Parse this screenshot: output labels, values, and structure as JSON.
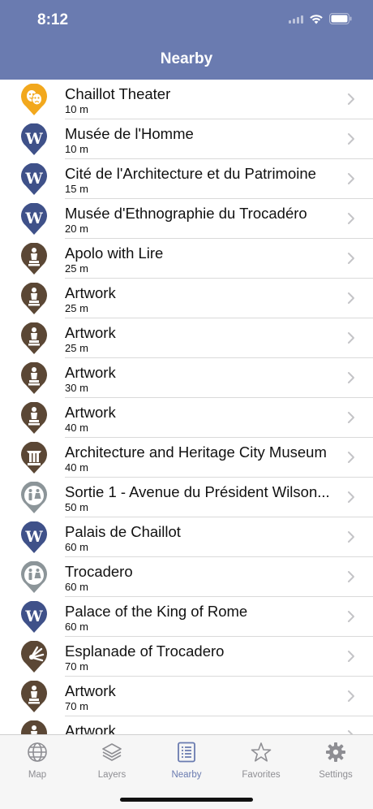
{
  "status": {
    "time": "8:12"
  },
  "nav": {
    "title": "Nearby"
  },
  "colors": {
    "header": "#6a7bb0",
    "wikipedia": "#3f5189",
    "artwork": "#5b4735",
    "theater": "#f2a81d",
    "transit": "#8c9599",
    "tab_active": "#6a7bb0",
    "tab_inactive": "#8e8e93"
  },
  "items": [
    {
      "name": "Chaillot Theater",
      "distance": "10 m",
      "icon": "theater-icon"
    },
    {
      "name": "Musée de l'Homme",
      "distance": "10 m",
      "icon": "wikipedia-icon"
    },
    {
      "name": "Cité de l'Architecture et du Patrimoine",
      "distance": "15 m",
      "icon": "wikipedia-icon"
    },
    {
      "name": "Musée d'Ethnographie du Trocadéro",
      "distance": "20 m",
      "icon": "wikipedia-icon"
    },
    {
      "name": "Apolo with Lire",
      "distance": "25 m",
      "icon": "statue-icon"
    },
    {
      "name": "Artwork",
      "distance": "25 m",
      "icon": "statue-icon"
    },
    {
      "name": "Artwork",
      "distance": "25 m",
      "icon": "statue-icon"
    },
    {
      "name": "Artwork",
      "distance": "30 m",
      "icon": "statue-icon"
    },
    {
      "name": "Artwork",
      "distance": "40 m",
      "icon": "statue-icon"
    },
    {
      "name": "Architecture and Heritage City Museum",
      "distance": "40 m",
      "icon": "museum-icon"
    },
    {
      "name": "Sortie 1 - Avenue du Président Wilson...",
      "distance": "50 m",
      "icon": "restroom-icon"
    },
    {
      "name": "Palais de Chaillot",
      "distance": "60 m",
      "icon": "wikipedia-icon"
    },
    {
      "name": "Trocadero",
      "distance": "60 m",
      "icon": "restroom-icon"
    },
    {
      "name": "Palace of the King of Rome",
      "distance": "60 m",
      "icon": "wikipedia-icon"
    },
    {
      "name": "Esplanade of Trocadero",
      "distance": "70 m",
      "icon": "viewpoint-icon"
    },
    {
      "name": "Artwork",
      "distance": "70 m",
      "icon": "statue-icon"
    },
    {
      "name": "Artwork",
      "distance": "",
      "icon": "statue-icon"
    }
  ],
  "tabs": [
    {
      "label": "Map",
      "icon": "globe-icon",
      "active": false
    },
    {
      "label": "Layers",
      "icon": "layers-icon",
      "active": false
    },
    {
      "label": "Nearby",
      "icon": "list-icon",
      "active": true
    },
    {
      "label": "Favorites",
      "icon": "star-icon",
      "active": false
    },
    {
      "label": "Settings",
      "icon": "gear-icon",
      "active": false
    }
  ]
}
